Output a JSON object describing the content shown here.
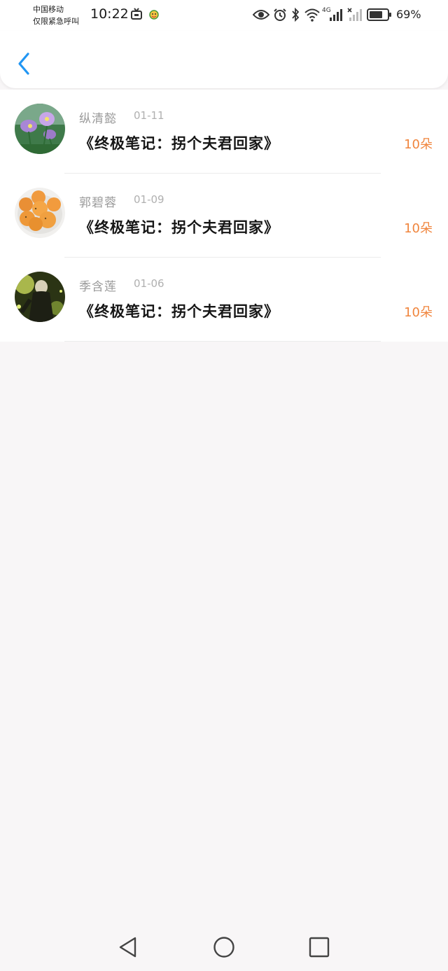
{
  "status_bar": {
    "carrier_line1": "中国移动",
    "carrier_line2": "仅限紧急呼叫",
    "time": "10:22",
    "network": "4G",
    "battery_percent": "69%",
    "icons": [
      "tv-icon",
      "emoji-icon",
      "eye-icon",
      "alarm-icon",
      "bluetooth-icon",
      "wifi-icon",
      "signal-icon",
      "no-signal-icon",
      "battery-icon"
    ]
  },
  "header": {
    "back_icon": "chevron-left-icon",
    "accent_color": "#2196f3"
  },
  "records": [
    {
      "name": "纵清懿",
      "date": "01-11",
      "title": "《终极笔记：拐个夫君回家》",
      "amount": "10朵"
    },
    {
      "name": "郭碧蓉",
      "date": "01-09",
      "title": "《终极笔记：拐个夫君回家》",
      "amount": "10朵"
    },
    {
      "name": "季含莲",
      "date": "01-06",
      "title": "《终极笔记：拐个夫君回家》",
      "amount": "10朵"
    }
  ],
  "colors": {
    "amount": "#f0853d",
    "name": "#9a9a9a",
    "title": "#161616",
    "background": "#f8f6f7"
  },
  "nav_bar": {
    "icons": [
      "back-triangle-icon",
      "home-circle-icon",
      "recents-square-icon"
    ]
  }
}
